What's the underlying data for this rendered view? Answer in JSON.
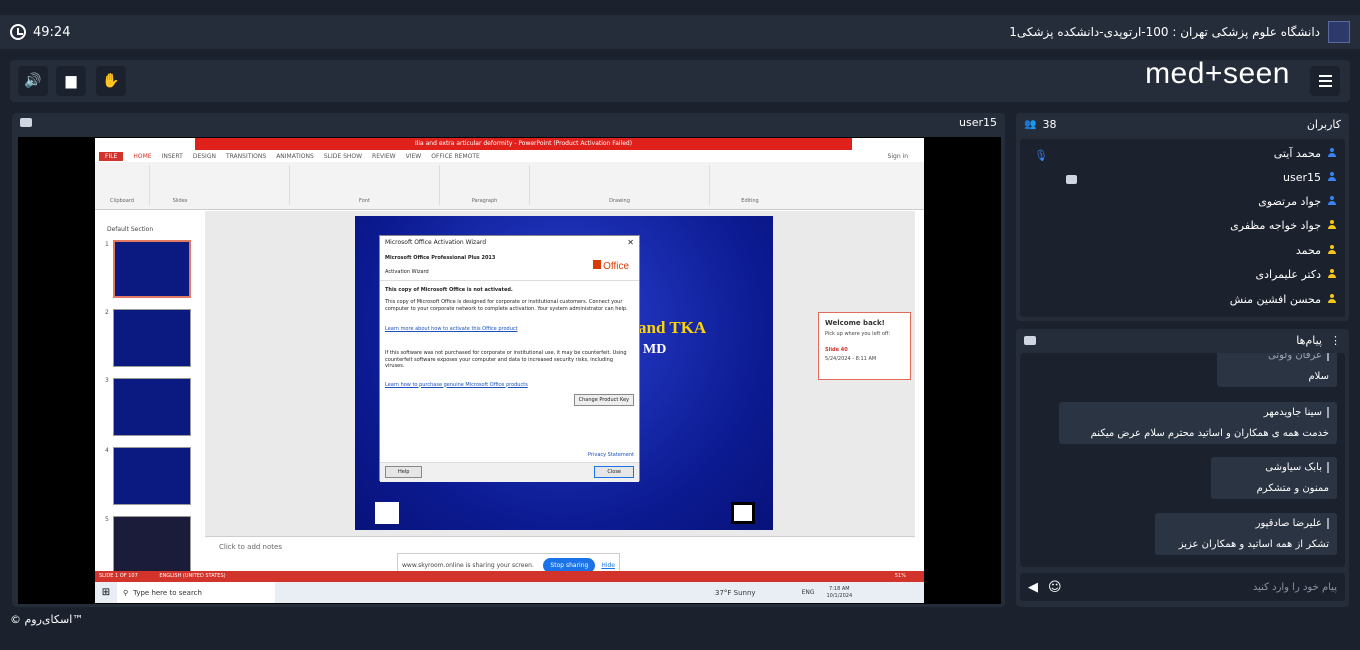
{
  "timer": "49:24",
  "room_title": "دانشگاه علوم پزشکی تهران : 100-ارتوپدی-دانشکده پزشکی1",
  "brand": "med+seen",
  "stage": {
    "presenter": "user15"
  },
  "ppt": {
    "window_title": "Ilia and extra articular deformity - PowerPoint (Product Activation Failed)",
    "tabs": [
      "FILE",
      "HOME",
      "INSERT",
      "DESIGN",
      "TRANSITIONS",
      "ANIMATIONS",
      "SLIDE SHOW",
      "REVIEW",
      "VIEW",
      "OFFICE REMOTE"
    ],
    "sign_in": "Sign in",
    "groups": [
      "Clipboard",
      "Slides",
      "Font",
      "Paragraph",
      "Drawing",
      "Editing"
    ],
    "section": "Default Section",
    "slide_numbers": [
      "1",
      "2",
      "3",
      "4",
      "5"
    ],
    "slide_title_text": "and TKA",
    "slide_sub_text": "MD",
    "notes": "Click to add notes",
    "status": "SLIDE 1 OF 107",
    "language": "ENGLISH (UNITED STATES)",
    "zoom": "51%",
    "dialog": {
      "title": "Microsoft Office Activation Wizard",
      "product": "Microsoft Office Professional Plus 2013",
      "subtitle": "Activation Wizard",
      "office_logo": "Office",
      "heading": "This copy of Microsoft Office is not activated.",
      "p1": "This copy of Microsoft Office is designed for corporate or institutional customers. Connect your computer to your corporate network to complete activation. Your system administrator can help.",
      "link1": "Learn more about how to activate this Office product",
      "p2": "If this software was not purchased for corporate or institutional use, it may be counterfeit. Using counterfeit software exposes your computer and data to increased security risks, including viruses.",
      "link2": "Learn how to purchase genuine Microsoft Office products",
      "change_key": "Change Product Key",
      "privacy": "Privacy Statement",
      "help": "Help",
      "close": "Close"
    },
    "welcome": {
      "title": "Welcome back!",
      "text": "Pick up where you left off:",
      "slide": "Slide 40",
      "date": "5/24/2024 - 8:11 AM"
    },
    "share": {
      "text": "www.skyroom.online is sharing your screen.",
      "stop": "Stop sharing",
      "hide": "Hide"
    },
    "taskbar": {
      "search": "Type here to search",
      "weather": "37°F Sunny",
      "lang": "ENG",
      "time": "7:18 AM",
      "date": "10/1/2024"
    }
  },
  "users": {
    "count": "38",
    "title": "کاربران",
    "list": [
      {
        "name": "محمد آیتی",
        "color": "#3b82f6"
      },
      {
        "name": "user15",
        "color": "#3b82f6"
      },
      {
        "name": "جواد مرتضوی",
        "color": "#3b82f6"
      },
      {
        "name": "جواد خواجه مظفری",
        "color": "#f5c518"
      },
      {
        "name": "محمد",
        "color": "#f5c518"
      },
      {
        "name": "دکتر علیمرادی",
        "color": "#f5c518"
      },
      {
        "name": "محسن افشین منش",
        "color": "#f5c518"
      }
    ]
  },
  "chat": {
    "title": "پیام‌ها",
    "messages": [
      {
        "name": "عرفان ولوتی",
        "text": "سلام"
      },
      {
        "name": "سینا جاویدمهر",
        "text": "خدمت همه ی همکاران و اساتید محترم سلام عرض میکنم"
      },
      {
        "name": "بابک سیاوشی",
        "text": "ممنون و متشکرم"
      },
      {
        "name": "علیرضا صادقپور",
        "text": "تشکر از همه اساتید و همکاران عزیز"
      }
    ],
    "placeholder": "پیام خود را وارد کنید"
  },
  "footer": "© اسکای‌روم™"
}
